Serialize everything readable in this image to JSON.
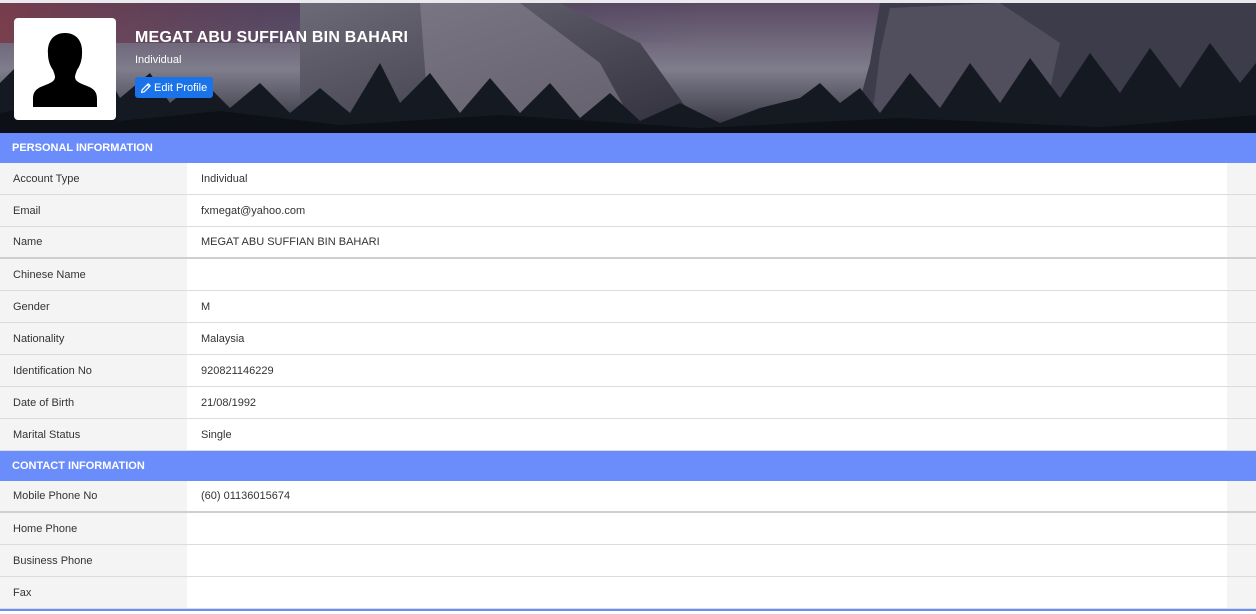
{
  "profile": {
    "name": "MEGAT ABU SUFFIAN BIN BAHARI",
    "type": "Individual",
    "edit_label": "Edit Profile"
  },
  "sections": {
    "personal": {
      "title": "PERSONAL INFORMATION",
      "rows": [
        {
          "label": "Account Type",
          "value": "Individual"
        },
        {
          "label": "Email",
          "value": "fxmegat@yahoo.com"
        },
        {
          "label": "Name",
          "value": "MEGAT ABU SUFFIAN BIN BAHARI"
        },
        {
          "label": "Chinese Name",
          "value": ""
        },
        {
          "label": "Gender",
          "value": "M"
        },
        {
          "label": "Nationality",
          "value": "Malaysia"
        },
        {
          "label": "Identification No",
          "value": "920821146229"
        },
        {
          "label": "Date of Birth",
          "value": "21/08/1992"
        },
        {
          "label": "Marital Status",
          "value": "Single"
        }
      ]
    },
    "contact": {
      "title": "CONTACT INFORMATION",
      "rows": [
        {
          "label": "Mobile Phone No",
          "value": "(60) 01136015674"
        },
        {
          "label": "Home Phone",
          "value": ""
        },
        {
          "label": "Business Phone",
          "value": ""
        },
        {
          "label": "Fax",
          "value": ""
        }
      ]
    }
  },
  "colors": {
    "section_header": "#6b8cfb",
    "edit_button": "#1a73e8",
    "label_bg": "#f4f4f4"
  },
  "icons": {
    "avatar": "user-silhouette-icon",
    "edit": "pencil-icon"
  }
}
